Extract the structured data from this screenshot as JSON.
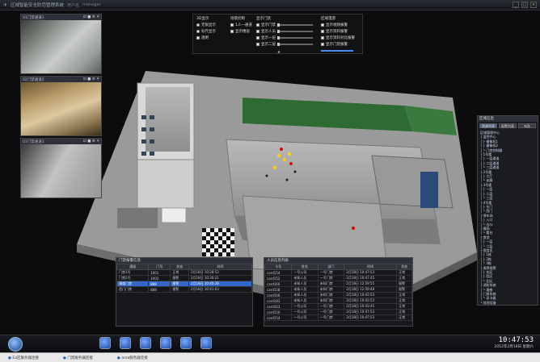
{
  "titlebar": {
    "title": "区域智能安全防范管理系统",
    "menu1": "用户名",
    "menu2": "manager",
    "ctl_min": "_",
    "ctl_max": "□",
    "ctl_close": "×"
  },
  "cameras": [
    {
      "title": "01门禁通道1",
      "icons": "⊡ ■ ⚙ ✕"
    },
    {
      "title": "02门禁通道2",
      "icons": "⊡ ■ ⚙ ✕"
    },
    {
      "title": "03门禁通道3",
      "icons": "⊡ ■ ⚙ ✕"
    }
  ],
  "control": {
    "col1": {
      "title": "3D显示",
      "opt1": "无限显示",
      "opt2": "标尺显示",
      "opt3": "透明"
    },
    "col2": {
      "title": "场景控制",
      "opt1": "1人一通道",
      "opt2": "显示楼层"
    },
    "col3": {
      "title": "显示门禁",
      "opt1": "显示门禁",
      "opt2": "显示人员",
      "opt3": "显示一层",
      "opt4": "显示二层"
    },
    "col4": {
      "title": "区域漫游",
      "opt1": "显示视频报警",
      "opt2": "显示资料报警",
      "opt3": "显示资料对比报警",
      "opt4": "显示门禁报警"
    },
    "toggle": "▲"
  },
  "rightpanel": {
    "title": "区域信息",
    "tabs": [
      "资源列表",
      "报警列表",
      "布防"
    ],
    "tree": [
      "区域管理中心",
      " ├ 监控中心",
      " │ ├ 摄像机1",
      " │ ├ 摄像机2",
      " │ └ 门禁控制器",
      " ├ 1号楼",
      " │ ├ 一层通道",
      " │ ├ 二层通道",
      " │ └ 三层通道",
      " ├ 2号楼",
      " │ ├ 大厅",
      " │ └ 走廊",
      " ├ 3号楼",
      " │ ├ 一层",
      " │ ├ 二层",
      " │ └ 三层",
      " ├ 4号楼",
      " │ ├ 东门",
      " │ └ 西门",
      " ├ 停车场",
      " │ ├ 入口",
      " │ └ 出口",
      " ├ 操场",
      " │ └ 看台",
      " ├ 食堂",
      " │ ├ 一层",
      " │ └ 二层",
      " ├ 宿舍区",
      " │ ├ 1栋",
      " │ ├ 2栋",
      " │ └ 3栋",
      " ├ 周界报警",
      " │ ├ 东区",
      " │ ├ 西区",
      " │ └ 北区",
      " ├ 消防系统",
      " │ └ 烟感",
      " ├ 门禁系统",
      " │ └ 读卡器",
      " └ 其他设备"
    ]
  },
  "table1": {
    "title": "门禁报警信息",
    "headers": [
      "通道",
      "门号",
      "状态",
      "时间"
    ],
    "rows": [
      [
        "门禁1号",
        "1001",
        "正常",
        "2月18日 10:28:53"
      ],
      [
        "门禁2号",
        "1002",
        "报警",
        "2月18日 10:30:21"
      ],
      [
        "通道门禁",
        "888",
        "报警",
        "2月18日 10:40:28"
      ],
      [
        "西门门禁",
        "888",
        "报警",
        "2月18日 10:41:03"
      ]
    ]
  },
  "table2": {
    "title": "人员信息列表",
    "headers": [
      "卡号",
      "姓名",
      "部门",
      "时间",
      "状态"
    ],
    "rows": [
      [
        "card154",
        "一号公司",
        "一号门禁",
        "2月18日 10:47:53",
        "正常"
      ],
      [
        "card152",
        "未知人员",
        "一号门禁",
        "2月18日 10:47:45",
        "正常"
      ],
      [
        "card166",
        "未知人员",
        "未知门禁",
        "2月18日 12:59:55",
        "报警"
      ],
      [
        "card158",
        "未知人员",
        "未知门禁",
        "2月18日 12:59:48",
        "报警"
      ],
      [
        "card166",
        "未知人员",
        "未知门禁",
        "2月18日 10:43:53",
        "正常"
      ],
      [
        "card183",
        "未知人员",
        "未知门禁",
        "2月18日 10:43:53",
        "正常"
      ],
      [
        "card163",
        "一号公司",
        "一号门禁",
        "2月18日 10:43:45",
        "正常"
      ],
      [
        "card150",
        "一号公司",
        "一号门禁",
        "2月18日 10:47:53",
        "正常"
      ],
      [
        "card154",
        "一号公司",
        "一号门禁",
        "2月18日 10:47:53",
        "正常"
      ]
    ]
  },
  "clock": {
    "time": "10:47:53",
    "date": "2012年2月18日 星期六"
  },
  "status": {
    "item1": "Ea区服务器连接",
    "item2": "门禁服务器连接",
    "item3": "area服务器连接"
  }
}
